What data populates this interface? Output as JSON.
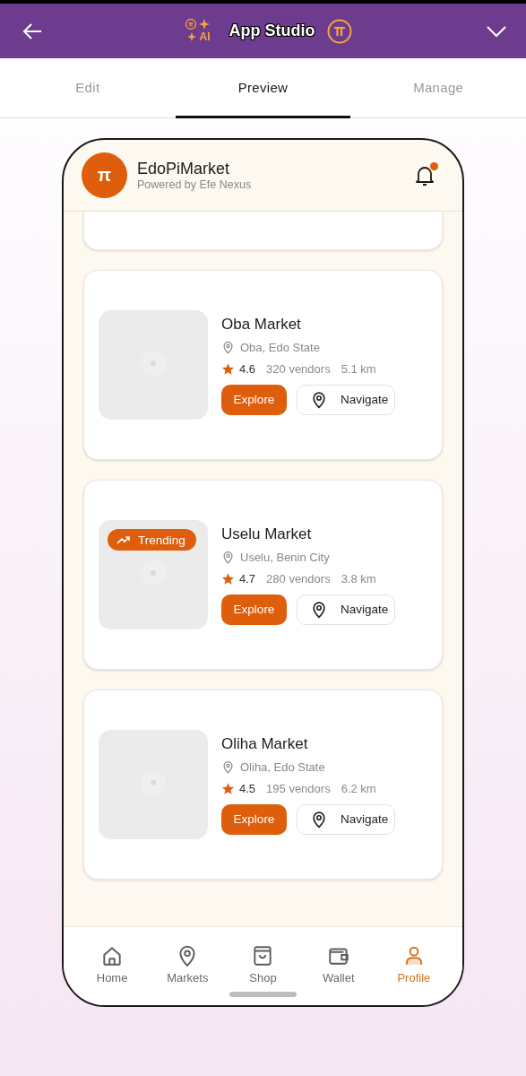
{
  "app_bar": {
    "title": "App Studio",
    "ai_label": "AI"
  },
  "tabs": [
    {
      "label": "Edit",
      "selected": false
    },
    {
      "label": "Preview",
      "selected": true
    },
    {
      "label": "Manage",
      "selected": false
    }
  ],
  "preview": {
    "logo": "π",
    "app_name": "EdoPiMarket",
    "tagline": "Powered by Efe Nexus",
    "notification_unread": true
  },
  "markets": [
    {
      "name": "Oba Market",
      "location": "Oba, Edo State",
      "rating": "4.6",
      "vendors": "320 vendors",
      "distance": "5.1 km",
      "primary_button": "Explore",
      "secondary_button": "Navigate"
    },
    {
      "name": "Uselu Market",
      "badge": "Trending",
      "location": "Uselu, Benin City",
      "rating": "4.7",
      "vendors": "280 vendors",
      "distance": "3.8 km",
      "primary_button": "Explore",
      "secondary_button": "Navigate"
    },
    {
      "name": "Oliha Market",
      "location": "Oliha, Edo State",
      "rating": "4.5",
      "vendors": "195 vendors",
      "distance": "6.2 km",
      "primary_button": "Explore",
      "secondary_button": "Navigate"
    }
  ],
  "bottom_nav": [
    {
      "kind": "home",
      "label": "Home",
      "selected": false
    },
    {
      "kind": "markets",
      "label": "Markets",
      "selected": false
    },
    {
      "kind": "shop",
      "label": "Shop",
      "selected": false
    },
    {
      "kind": "wallet",
      "label": "Wallet",
      "selected": false
    },
    {
      "kind": "profile",
      "label": "Profile",
      "selected": true
    }
  ]
}
